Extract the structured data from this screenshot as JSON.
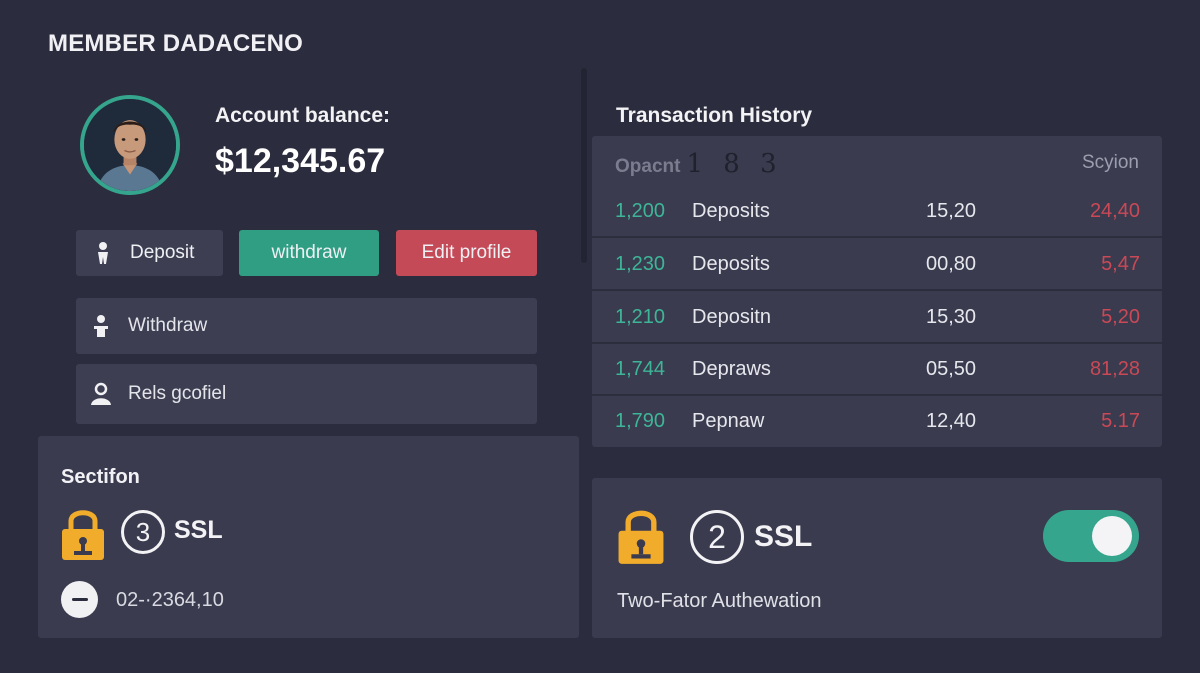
{
  "header": {
    "title": "MEMBER DADACENO"
  },
  "account": {
    "balance_label": "Account balance:",
    "balance_value": "$12,345.67"
  },
  "actions": {
    "deposit_label": "Deposit",
    "withdraw_label": "withdraw",
    "edit_profile_label": "Edit profile"
  },
  "menu": [
    {
      "label": "Withdraw",
      "icon": "person-icon"
    },
    {
      "label": "Rels gcofiel",
      "icon": "user-icon"
    }
  ],
  "security": {
    "title": "Sectifon",
    "badge_number": "3",
    "protocol": "SSL",
    "code": "02-·2364,10"
  },
  "transactions": {
    "heading": "Transaction History",
    "header_left": "Opacnt",
    "header_left_num": "1 8 3",
    "header_right": "Scyion",
    "rows": [
      {
        "amount": "1,200",
        "type": "Deposits",
        "value": "15,20",
        "change": "24,40"
      },
      {
        "amount": "1,230",
        "type": "Deposits",
        "value": "00,80",
        "change": "5,47"
      },
      {
        "amount": "1,210",
        "type": "Depositn",
        "value": "15,30",
        "change": "5,20"
      },
      {
        "amount": "1,744",
        "type": "Depraws",
        "value": "05,50",
        "change": "81,28"
      },
      {
        "amount": "1,790",
        "type": "Pepnaw",
        "value": "12,40",
        "change": "5.17"
      }
    ]
  },
  "two_factor": {
    "badge_number": "2",
    "protocol": "SSL",
    "label": "Two-Fator Authewation",
    "enabled": true
  },
  "colors": {
    "background": "#2b2c3d",
    "panel": "#3a3b4f",
    "accent_green": "#35a58d",
    "accent_red": "#c44a58",
    "lock_orange": "#f2ac2c"
  }
}
